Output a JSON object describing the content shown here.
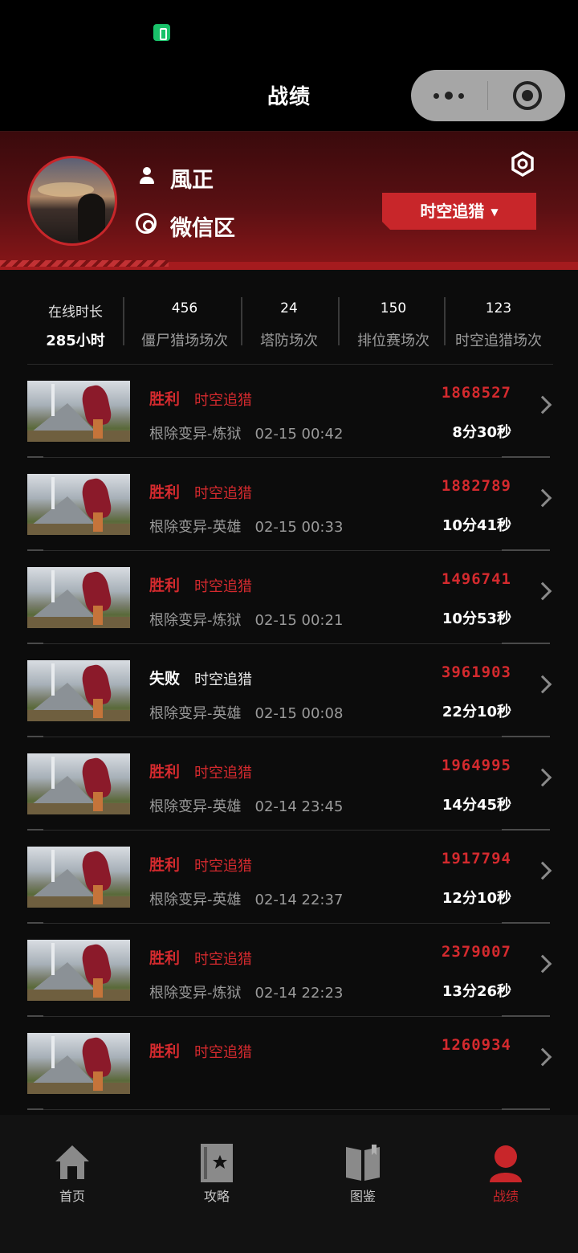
{
  "header": {
    "title": "战绩"
  },
  "profile": {
    "name": "風正",
    "server": "微信区",
    "mode_button": "时空追猎",
    "mode_caret": "▼"
  },
  "stats": {
    "online_label": "在线时长",
    "online_value": "285小时",
    "items": [
      {
        "value": "456",
        "label": "僵尸猎场场次"
      },
      {
        "value": "24",
        "label": "塔防场次"
      },
      {
        "value": "150",
        "label": "排位赛场次"
      },
      {
        "value": "123",
        "label": "时空追猎场次"
      }
    ]
  },
  "matches": [
    {
      "result": "胜利",
      "status": "win",
      "mode": "时空追猎",
      "map": "根除变异-炼狱",
      "time": "02-15 00:42",
      "score": "1868527",
      "duration": "8分30秒"
    },
    {
      "result": "胜利",
      "status": "win",
      "mode": "时空追猎",
      "map": "根除变异-英雄",
      "time": "02-15 00:33",
      "score": "1882789",
      "duration": "10分41秒"
    },
    {
      "result": "胜利",
      "status": "win",
      "mode": "时空追猎",
      "map": "根除变异-炼狱",
      "time": "02-15 00:21",
      "score": "1496741",
      "duration": "10分53秒"
    },
    {
      "result": "失败",
      "status": "lose",
      "mode": "时空追猎",
      "map": "根除变异-英雄",
      "time": "02-15 00:08",
      "score": "3961903",
      "duration": "22分10秒"
    },
    {
      "result": "胜利",
      "status": "win",
      "mode": "时空追猎",
      "map": "根除变异-英雄",
      "time": "02-14 23:45",
      "score": "1964995",
      "duration": "14分45秒"
    },
    {
      "result": "胜利",
      "status": "win",
      "mode": "时空追猎",
      "map": "根除变异-英雄",
      "time": "02-14 22:37",
      "score": "1917794",
      "duration": "12分10秒"
    },
    {
      "result": "胜利",
      "status": "win",
      "mode": "时空追猎",
      "map": "根除变异-炼狱",
      "time": "02-14 22:23",
      "score": "2379007",
      "duration": "13分26秒"
    },
    {
      "result": "胜利",
      "status": "win",
      "mode": "时空追猎",
      "map": "",
      "time": "",
      "score": "1260934",
      "duration": ""
    }
  ],
  "tabs": [
    {
      "label": "首页",
      "icon": "home-icon"
    },
    {
      "label": "攻略",
      "icon": "guide-icon"
    },
    {
      "label": "图鉴",
      "icon": "book-icon"
    },
    {
      "label": "战绩",
      "icon": "record-icon",
      "active": true
    }
  ],
  "colors": {
    "accent": "#c8262a",
    "win": "#d42a2e",
    "background": "#0c0c0c"
  }
}
